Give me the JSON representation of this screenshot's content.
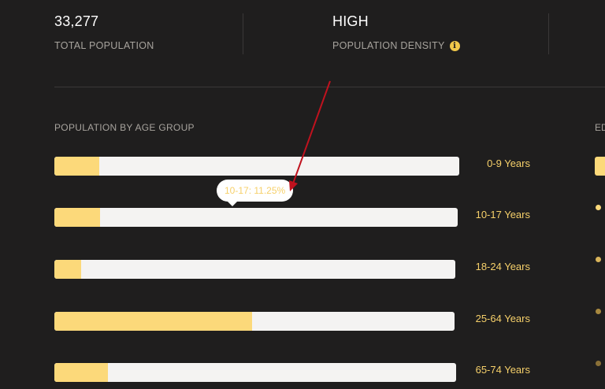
{
  "stats": {
    "total_population": {
      "value": "33,277",
      "label": "TOTAL POPULATION"
    },
    "population_density": {
      "value": "HIGH",
      "label": "POPULATION DENSITY",
      "info_icon": "info-icon"
    }
  },
  "age_section": {
    "title": "POPULATION BY AGE GROUP",
    "bars": [
      {
        "label": "0-9 Years",
        "fill": 0.11
      },
      {
        "label": "10-17 Years",
        "fill": 0.1125
      },
      {
        "label": "18-24 Years",
        "fill": 0.067
      },
      {
        "label": "25-64 Years",
        "fill": 0.494
      },
      {
        "label": "65-74 Years",
        "fill": 0.133
      }
    ],
    "tooltip": "10-17: 11.25%"
  },
  "right_section": {
    "title_fragment": "ED",
    "dot_colors": [
      "#fcd97a",
      "#d9b45a",
      "#a8893f",
      "#8a7037"
    ]
  },
  "colors": {
    "background": "#1f1e1e",
    "bar_fill": "#fcd97a",
    "bar_track": "#f4f3f2",
    "label_accent": "#f6d06a",
    "annotation_arrow": "#c0121e"
  }
}
